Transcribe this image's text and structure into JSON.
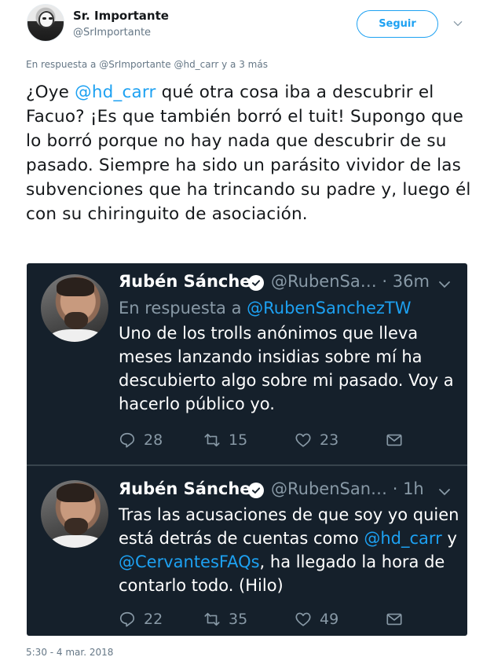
{
  "author": {
    "name": "Sr. Importante",
    "handle": "@SrImportante",
    "follow_label": "Seguir"
  },
  "reply_context": {
    "prefix": "En respuesta a ",
    "mentions": "@SrImportante @hd_carr",
    "suffix": " y a 3 más"
  },
  "tweet": {
    "part1": "¿Oye ",
    "mention1": "@hd_carr",
    "part2": " qué otra cosa iba a descubrir el Facuo? ¡Es que también borró el tuit! Supongo que lo borró porque no hay nada que descubrir de su pasado. Siempre ha sido un parásito vividor de las subvenciones que ha trincando su padre y, luego él con su chiringuito de asociación.",
    "timestamp": "5:30 - 4 mar. 2018"
  },
  "embedded": [
    {
      "name": "Яubén Sánchez",
      "handle": "@RubenSa…",
      "time": "· 36m",
      "reply_prefix": "En respuesta a ",
      "reply_mention": "@RubenSanchezTW",
      "text": "Uno de los trolls anónimos que lleva meses lanzando insidias sobre mí ha descubierto algo sobre mi pasado. Voy a hacerlo público yo.",
      "replies": "28",
      "retweets": "15",
      "likes": "23"
    },
    {
      "name": "Яubén Sánchez",
      "handle": "@RubenSan…",
      "time": "· 1h",
      "text_part1": "Tras las acusaciones de que soy yo quien está detrás de cuentas como ",
      "text_mention1": "@hd_carr",
      "text_part2": " y ",
      "text_mention2": "@CervantesFAQs",
      "text_part3": ", ha llegado la hora de contarlo todo. (Hilo)",
      "replies": "22",
      "retweets": "35",
      "likes": "49"
    }
  ],
  "colors": {
    "accent": "#1da1f2",
    "embed_bg": "#15202b",
    "muted": "#8899a6"
  },
  "icons": [
    "reply-icon",
    "retweet-icon",
    "like-icon",
    "dm-icon",
    "verified-icon",
    "chevron-down-icon"
  ]
}
